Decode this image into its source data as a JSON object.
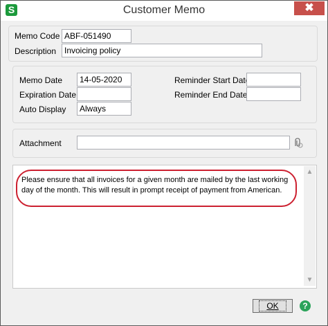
{
  "window": {
    "title": "Customer Memo",
    "app_icon": "S",
    "close_glyph": "✖"
  },
  "header": {
    "memo_code_label": "Memo Code",
    "memo_code_value": "ABF-051490",
    "description_label": "Description",
    "description_value": "Invoicing policy"
  },
  "dates": {
    "memo_date_label": "Memo Date",
    "memo_date_value": "14-05-2020",
    "expiration_date_label": "Expiration Date",
    "expiration_date_value": "",
    "auto_display_label": "Auto Display",
    "auto_display_value": "Always",
    "reminder_start_label": "Reminder Start Date",
    "reminder_start_value": "",
    "reminder_end_label": "Reminder End Date",
    "reminder_end_value": ""
  },
  "attachment": {
    "label": "Attachment",
    "value": "",
    "icon": "paperclip-icon"
  },
  "memo": {
    "text": "Please ensure that all invoices for a given month are mailed by the last working day of the month.  This will result in prompt receipt of payment from American."
  },
  "footer": {
    "ok_label": "OK",
    "help_glyph": "?"
  },
  "colors": {
    "highlight": "#cc2030",
    "close": "#c7504b",
    "app_icon": "#1c9a3c",
    "help": "#2ba35a"
  }
}
